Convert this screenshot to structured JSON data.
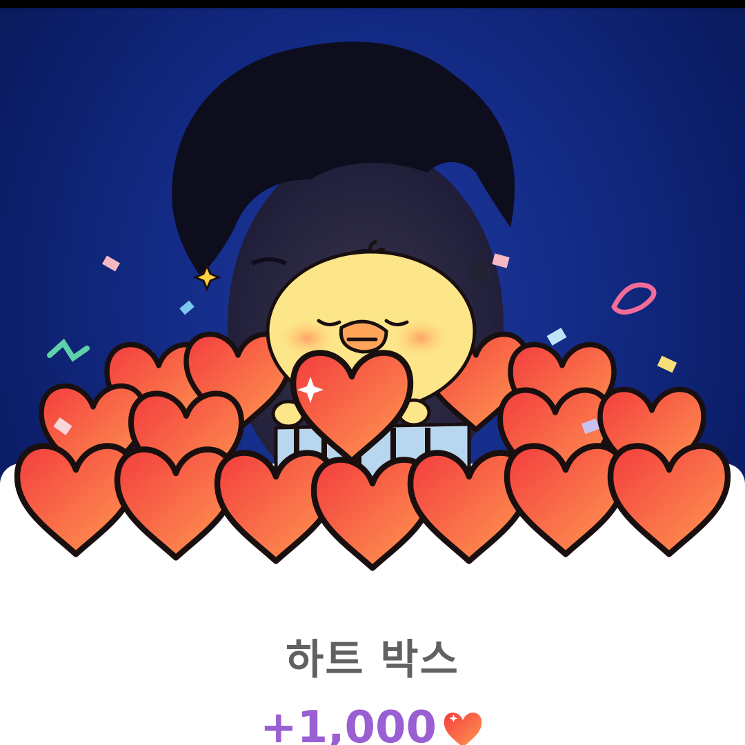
{
  "reward": {
    "title": "하트 박스",
    "amount": "+1,000"
  },
  "icons": {
    "amount": "heart-icon"
  },
  "colors": {
    "background": "#132b86",
    "sheet": "#ffffff",
    "title_text": "#616161",
    "amount_text": "#9a5fd2",
    "heart": "#f0554a",
    "chick": "#fde58a"
  }
}
